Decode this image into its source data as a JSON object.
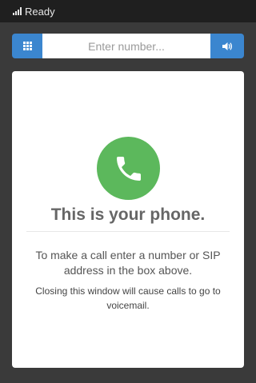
{
  "status": {
    "text": "Ready"
  },
  "dialer": {
    "placeholder": "Enter number...",
    "value": "",
    "keypad_icon": "keypad-grid-icon",
    "speaker_icon": "speaker-volume-icon"
  },
  "card": {
    "phone_icon": "phone-handset-icon",
    "title": "This is your phone.",
    "instructions": "To make a call enter a number or SIP address in the box above.",
    "note": "Closing this window will cause calls to go to voicemail."
  },
  "colors": {
    "accent": "#3b86cf",
    "call_green": "#5cb85c",
    "background": "#3a3a3a",
    "statusbar": "#1f1f1f"
  }
}
